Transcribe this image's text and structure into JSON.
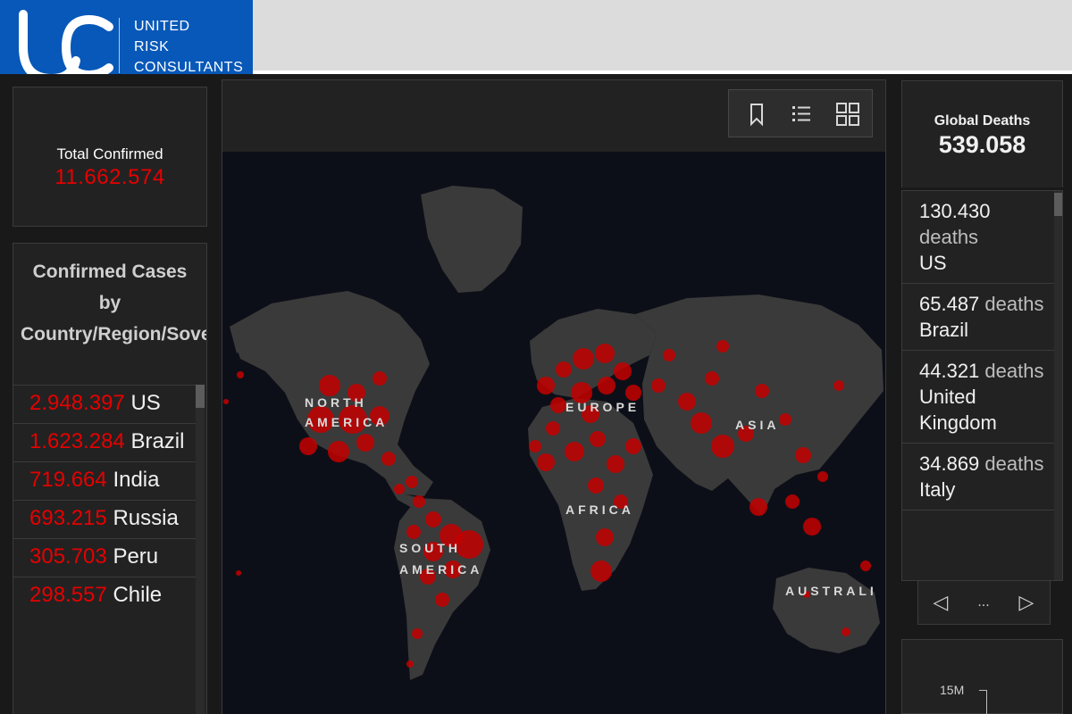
{
  "header": {
    "logo_text": [
      "UNITED",
      "RISK",
      "CONSULTANTS"
    ],
    "logo_letters": "UC",
    "brand_color": "#0758b8"
  },
  "total_confirmed": {
    "label": "Total Confirmed",
    "value": "11.662.574"
  },
  "confirmed_by_country": {
    "title": "Confirmed Cases by Country/Region/Sovereignty",
    "items": [
      {
        "value": "2.948.397",
        "country": "US"
      },
      {
        "value": "1.623.284",
        "country": "Brazil"
      },
      {
        "value": "719.664",
        "country": "India"
      },
      {
        "value": "693.215",
        "country": "Russia"
      },
      {
        "value": "305.703",
        "country": "Peru"
      },
      {
        "value": "298.557",
        "country": "Chile"
      }
    ]
  },
  "map": {
    "toolbar": [
      "bookmark-icon",
      "legend-list-icon",
      "basemap-gallery-icon"
    ],
    "region_labels": {
      "north_america": [
        "NORTH",
        "AMERICA"
      ],
      "south_america": [
        "SOUTH",
        "AMERICA"
      ],
      "europe": "EUROPE",
      "asia": "ASIA",
      "africa": "AFRICA",
      "australia": "AUSTRALI"
    }
  },
  "global_deaths": {
    "label": "Global Deaths",
    "value": "539.058",
    "items": [
      {
        "value": "130.430",
        "unit": "deaths",
        "country": "US"
      },
      {
        "value": "65.487",
        "unit": "deaths",
        "country": "Brazil"
      },
      {
        "value": "44.321",
        "unit": "deaths",
        "country": "United Kingdom"
      },
      {
        "value": "34.869",
        "unit": "deaths",
        "country": "Italy"
      }
    ],
    "pager": {
      "prev": "◁",
      "middle": "...",
      "next": "▷"
    }
  },
  "mini_chart": {
    "tick_label": "15M"
  },
  "colors": {
    "confirmed_red": "#e60000",
    "panel_bg": "#222222",
    "dashboard_bg": "#191919"
  }
}
